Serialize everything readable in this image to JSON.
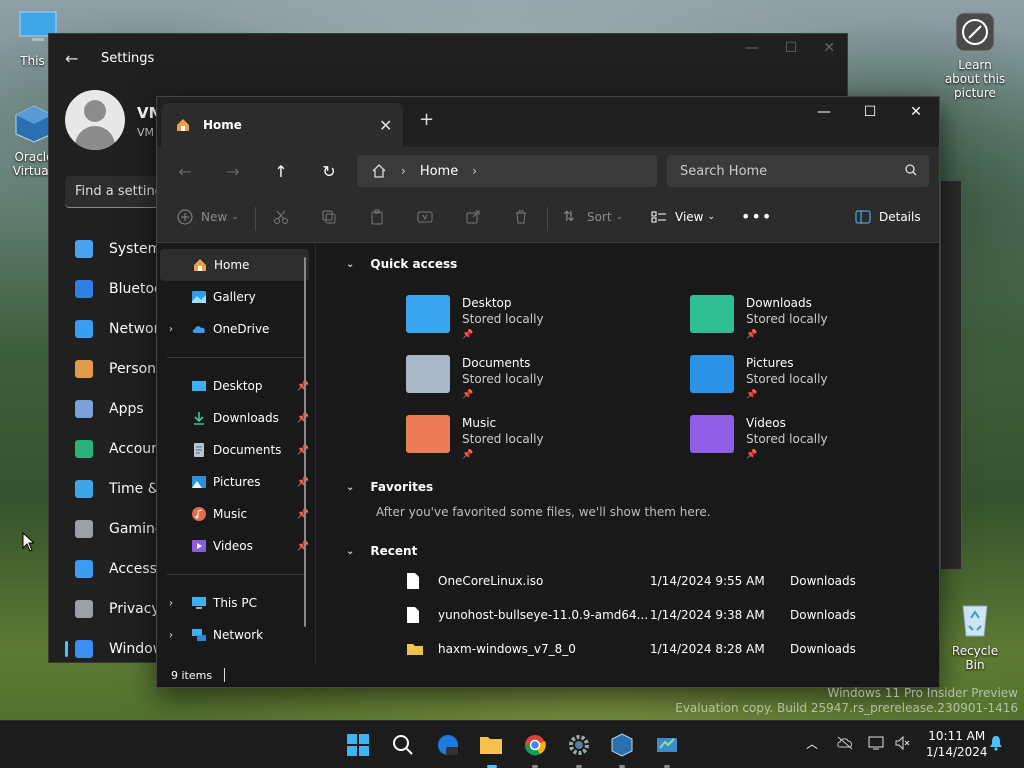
{
  "desktop": {
    "icons": [
      {
        "label": "This P"
      },
      {
        "label": "Oracle Virtuall"
      },
      {
        "label": "Learn about this picture"
      },
      {
        "label": "Recycle Bin"
      }
    ],
    "watermark": [
      "Windows 11 Pro Insider Preview",
      "Evaluation copy. Build 25947.rs_prerelease.230901-1416"
    ]
  },
  "settings": {
    "title": "Settings",
    "user_name": "VM",
    "user_email": "VM",
    "find_placeholder": "Find a setting",
    "nav": [
      "System",
      "Bluetoo",
      "Networ",
      "Persona",
      "Apps",
      "Accoun",
      "Time &",
      "Gaming",
      "Accessi",
      "Privacy",
      "Window"
    ],
    "nav_colors": [
      "#4aa3f0",
      "#2f7fe3",
      "#3a9ff0",
      "#e29a4b",
      "#7aa2d8",
      "#29b37a",
      "#3ea5e8",
      "#9aa0a6",
      "#3b9cf0",
      "#9aa0a6",
      "#3b8ff0"
    ]
  },
  "explorer": {
    "tab_title": "Home",
    "breadcrumb": "Home",
    "search_placeholder": "Search Home",
    "commands": {
      "new": "New",
      "sort": "Sort",
      "view": "View",
      "details": "Details"
    },
    "sidebar": {
      "top": [
        "Home",
        "Gallery",
        "OneDrive"
      ],
      "pinned": [
        "Desktop",
        "Downloads",
        "Documents",
        "Pictures",
        "Music",
        "Videos"
      ],
      "bottom": [
        "This PC",
        "Network"
      ]
    },
    "sections": {
      "quick_access": "Quick access",
      "favorites": "Favorites",
      "favorites_hint": "After you've favorited some files, we'll show them here.",
      "recent": "Recent"
    },
    "quick_access": [
      {
        "name": "Desktop",
        "sub": "Stored locally"
      },
      {
        "name": "Downloads",
        "sub": "Stored locally"
      },
      {
        "name": "Documents",
        "sub": "Stored locally"
      },
      {
        "name": "Pictures",
        "sub": "Stored locally"
      },
      {
        "name": "Music",
        "sub": "Stored locally"
      },
      {
        "name": "Videos",
        "sub": "Stored locally"
      }
    ],
    "recent": [
      {
        "name": "OneCoreLinux.iso",
        "date": "1/14/2024 9:55 AM",
        "loc": "Downloads"
      },
      {
        "name": "yunohost-bullseye-11.0.9-amd64...",
        "date": "1/14/2024 9:38 AM",
        "loc": "Downloads"
      },
      {
        "name": "haxm-windows_v7_8_0",
        "date": "1/14/2024 8:28 AM",
        "loc": "Downloads"
      }
    ],
    "status": "9 items"
  },
  "taskbar": {
    "time": "10:11 AM",
    "date": "1/14/2024"
  }
}
